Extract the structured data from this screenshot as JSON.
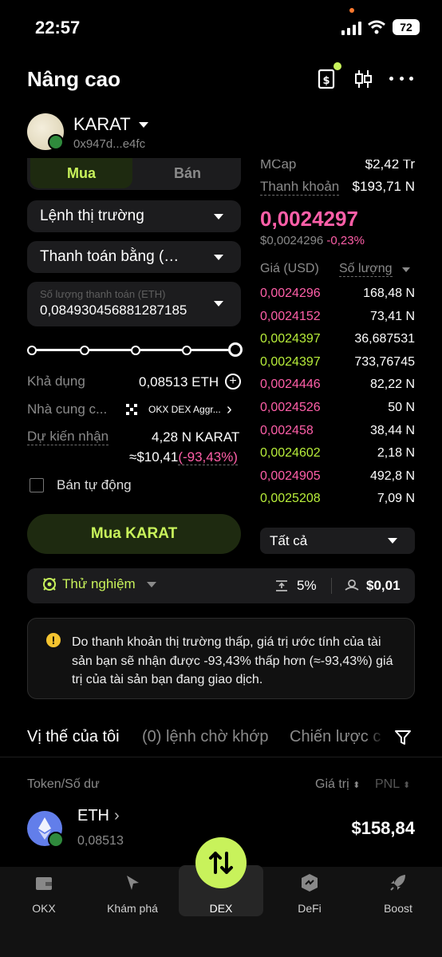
{
  "status_bar": {
    "time": "22:57",
    "battery": "72"
  },
  "header": {
    "title": "Nâng cao"
  },
  "token": {
    "name": "KARAT",
    "address": "0x947d...e4fc"
  },
  "trade": {
    "tab_buy": "Mua",
    "tab_sell": "Bán",
    "order_type": "Lệnh thị trường",
    "pay_with": "Thanh toán bằng (…",
    "amount_label": "Số lượng thanh toán (ETH)",
    "amount_value": "0,084930456881287185",
    "available_label": "Khả dụng",
    "available_value": "0,08513 ETH",
    "provider_label": "Nhà cung c...",
    "provider_value": "OKX DEX Aggr...",
    "expected_label": "Dự kiến nhận",
    "expected_value": "4,28 N KARAT",
    "expected_usd": "≈$10,41",
    "expected_change": "(-93,43%)",
    "auto_sell": "Bán tự động",
    "buy_button": "Mua KARAT",
    "slider_value": 1.0
  },
  "market": {
    "mcap_label": "MCap",
    "mcap_value": "$2,42 Tr",
    "liquidity_label": "Thanh khoản",
    "liquidity_value": "$193,71 N",
    "price": "0,0024297",
    "price_usd": "$0,0024296",
    "price_change": "-0,23%",
    "col_price": "Giá (USD)",
    "col_amount": "Số lượng",
    "filter": "Tất cả"
  },
  "orderbook": [
    {
      "price": "0,0024296",
      "amount": "168,48 N",
      "side": "sell"
    },
    {
      "price": "0,0024152",
      "amount": "73,41 N",
      "side": "sell"
    },
    {
      "price": "0,0024397",
      "amount": "36,687531",
      "side": "buy"
    },
    {
      "price": "0,0024397",
      "amount": "733,76745",
      "side": "buy"
    },
    {
      "price": "0,0024446",
      "amount": "82,22 N",
      "side": "sell"
    },
    {
      "price": "0,0024526",
      "amount": "50 N",
      "side": "sell"
    },
    {
      "price": "0,002458",
      "amount": "38,44 N",
      "side": "sell"
    },
    {
      "price": "0,0024602",
      "amount": "2,18 N",
      "side": "buy"
    },
    {
      "price": "0,0024905",
      "amount": "492,8 N",
      "side": "sell"
    },
    {
      "price": "0,0025208",
      "amount": "7,09 N",
      "side": "buy"
    }
  ],
  "settings_bar": {
    "mode": "Thử nghiệm",
    "slippage": "5%",
    "fee": "$0,01"
  },
  "warning": {
    "text": "Do thanh khoản thị trường thấp, giá trị ước tính của tài sản bạn sẽ nhận được -93,43% thấp hơn (≈-93,43%) giá trị của tài sản bạn đang giao dịch."
  },
  "positions": {
    "tab_mine": "Vị thế của tôi",
    "tab_pending": "(0) lệnh chờ khớp",
    "tab_strategy": "Chiến lược c",
    "col_token": "Token/Số dư",
    "col_value": "Giá trị",
    "col_pnl": "PNL",
    "asset_name": "ETH",
    "asset_balance": "0,08513",
    "asset_value": "$158,84"
  },
  "bottom_nav": {
    "okx": "OKX",
    "explore": "Khám phá",
    "dex": "DEX",
    "defi": "DeFi",
    "boost": "Boost"
  },
  "colors": {
    "accent": "#c8f25b",
    "sell": "#ff5fa8",
    "buy": "#b8ee3a",
    "background": "#000000"
  },
  "icons": [
    "signal-icon",
    "wifi-icon",
    "battery-icon",
    "dollar-doc-icon",
    "candle-chart-icon",
    "more-icon",
    "plus-circle-icon",
    "chevron-right-icon",
    "warning-icon",
    "filter-icon",
    "wallet-icon",
    "compass-icon",
    "swap-icon",
    "defi-icon",
    "rocket-icon"
  ]
}
